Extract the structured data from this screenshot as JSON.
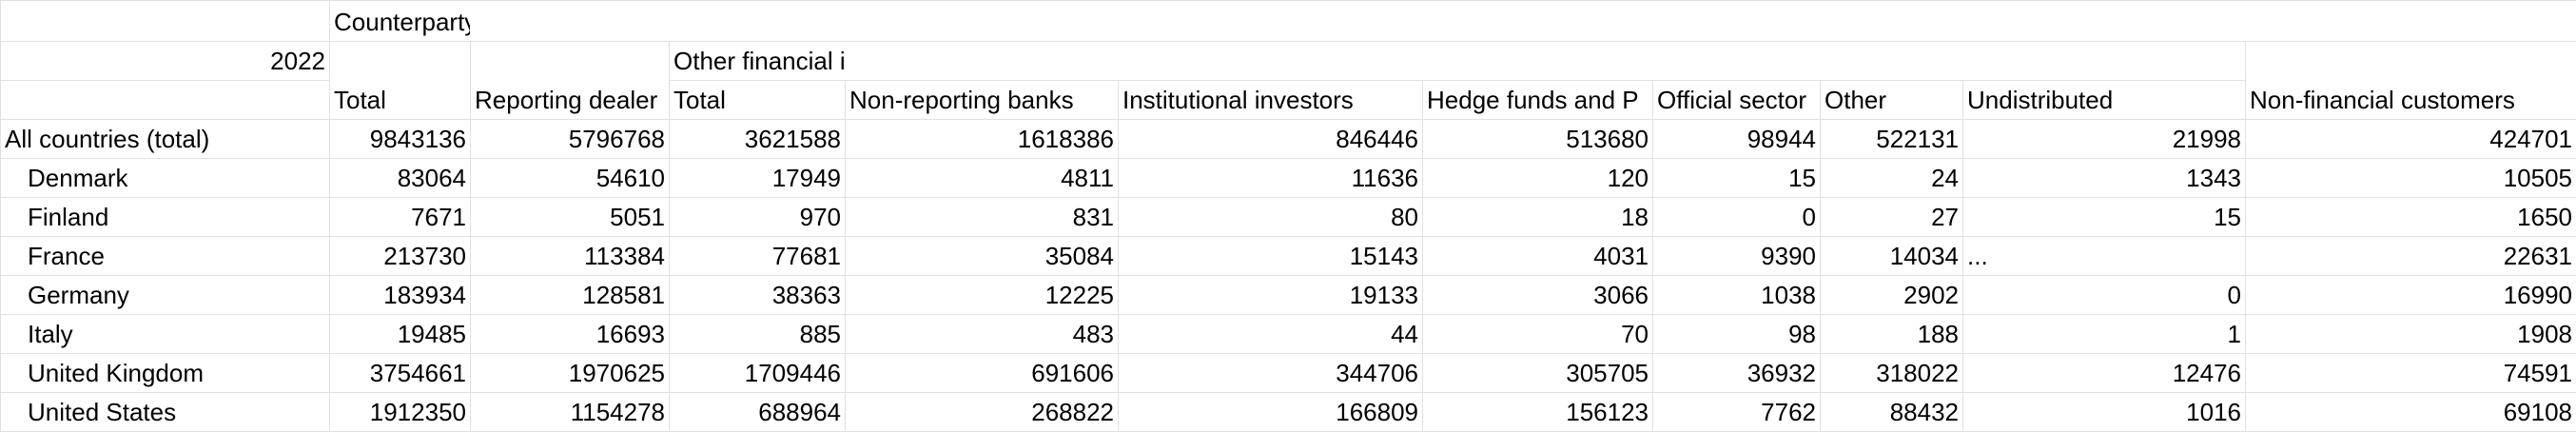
{
  "header": {
    "year": "2022",
    "counterparty_sector": "Counterparty sector",
    "other_financial_institutions": "Other financial institutions",
    "columns": [
      "Total",
      "Reporting dealer",
      "Total",
      "Non-reporting banks",
      "Institutional investors",
      "Hedge funds and P",
      "Official sector",
      "Other",
      "Undistributed",
      "Non-financial customers"
    ]
  },
  "rows": [
    {
      "label": "All countries (total)",
      "values": [
        "9843136",
        "5796768",
        "3621588",
        "1618386",
        "846446",
        "513680",
        "98944",
        "522131",
        "21998",
        "424701"
      ]
    },
    {
      "label": "Denmark",
      "values": [
        "83064",
        "54610",
        "17949",
        "4811",
        "11636",
        "120",
        "15",
        "24",
        "1343",
        "10505"
      ]
    },
    {
      "label": "Finland",
      "values": [
        "7671",
        "5051",
        "970",
        "831",
        "80",
        "18",
        "0",
        "27",
        "15",
        "1650"
      ]
    },
    {
      "label": "France",
      "values": [
        "213730",
        "113384",
        "77681",
        "35084",
        "15143",
        "4031",
        "9390",
        "14034",
        "...",
        "22631"
      ]
    },
    {
      "label": "Germany",
      "values": [
        "183934",
        "128581",
        "38363",
        "12225",
        "19133",
        "3066",
        "1038",
        "2902",
        "0",
        "16990"
      ]
    },
    {
      "label": "Italy",
      "values": [
        "19485",
        "16693",
        "885",
        "483",
        "44",
        "70",
        "98",
        "188",
        "1",
        "1908"
      ]
    },
    {
      "label": "United Kingdom",
      "values": [
        "3754661",
        "1970625",
        "1709446",
        "691606",
        "344706",
        "305705",
        "36932",
        "318022",
        "12476",
        "74591"
      ]
    },
    {
      "label": "United States",
      "values": [
        "1912350",
        "1154278",
        "688964",
        "268822",
        "166809",
        "156123",
        "7762",
        "88432",
        "1016",
        "69108"
      ]
    }
  ]
}
